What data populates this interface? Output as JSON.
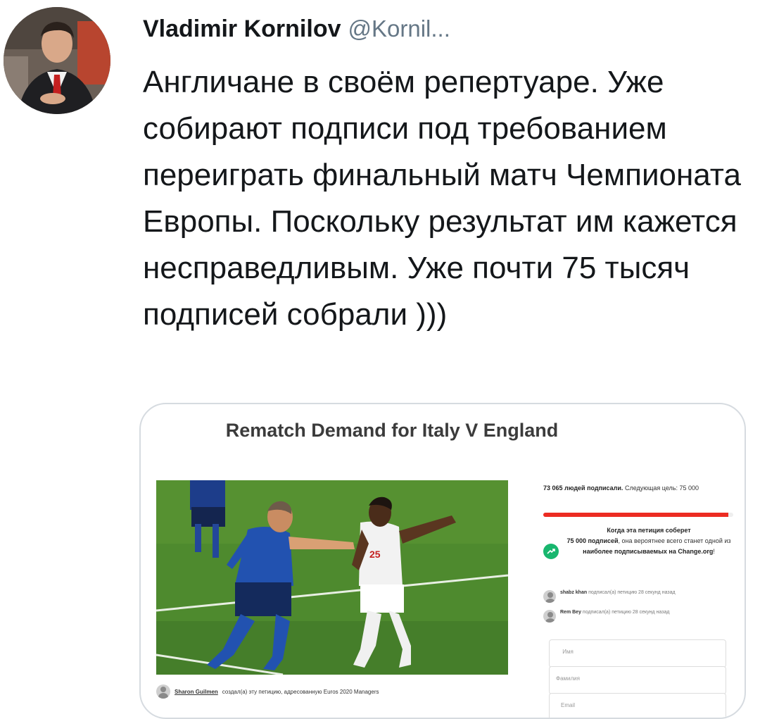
{
  "tweet": {
    "author_name": "Vladimir Kornilov",
    "author_handle": "@Kornil...",
    "text": "Англичане в своём репертуаре. Уже собирают подписи под требованием переиграть финальный матч Чемпионата Европы. Поскольку результат им кажется несправедливым. Уже почти 75 тысяч подписей собрали )))"
  },
  "card": {
    "title": "Rematch Demand for Italy V England",
    "creator_name": "Sharon Guilmen",
    "creator_text": "создал(а) эту петицию, адресованную Euros 2020 Managers",
    "count_bold": "73 065 людей подписали.",
    "count_rest": "Следующая цель: 75 000",
    "progress_fraction": 0.974,
    "promo": {
      "line1": "Когда эта петиция соберет",
      "goal_bold": "75 000 подписей",
      "line2": ", она вероятнее всего станет одной из",
      "bold_end": "наиболее подписываемых на Change.org",
      "end": "!"
    },
    "signers": [
      {
        "name": "shabz khan",
        "text": "подписал(а) петицию 28 секунд назад"
      },
      {
        "name": "Rem Bey",
        "text": "подписал(а) петицию 28 секунд назад"
      }
    ],
    "fields": [
      {
        "placeholder": "Имя"
      },
      {
        "placeholder": "Фамилия"
      },
      {
        "placeholder": "Email"
      }
    ],
    "player_number": "25"
  },
  "colors": {
    "progress": "#ec2c22",
    "promo_icon": "#18b66e",
    "handle": "#657786"
  }
}
